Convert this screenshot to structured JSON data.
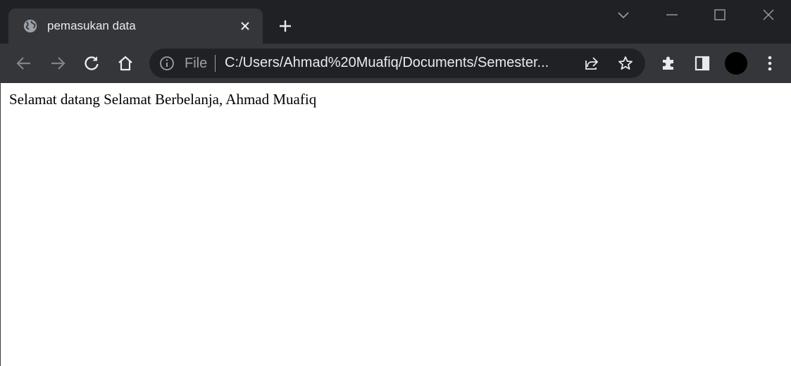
{
  "browser": {
    "tab": {
      "title": "pemasukan data",
      "favicon": "globe-icon"
    },
    "omnibox": {
      "scheme_label": "File",
      "url": "C:/Users/Ahmad%20Muafiq/Documents/Semester..."
    },
    "colors": {
      "titlebar": "#202124",
      "toolbar": "#35363a",
      "text": "#e8eaed"
    }
  },
  "page": {
    "greeting": "Selamat datang Selamat Berbelanja, Ahmad Muafiq"
  }
}
